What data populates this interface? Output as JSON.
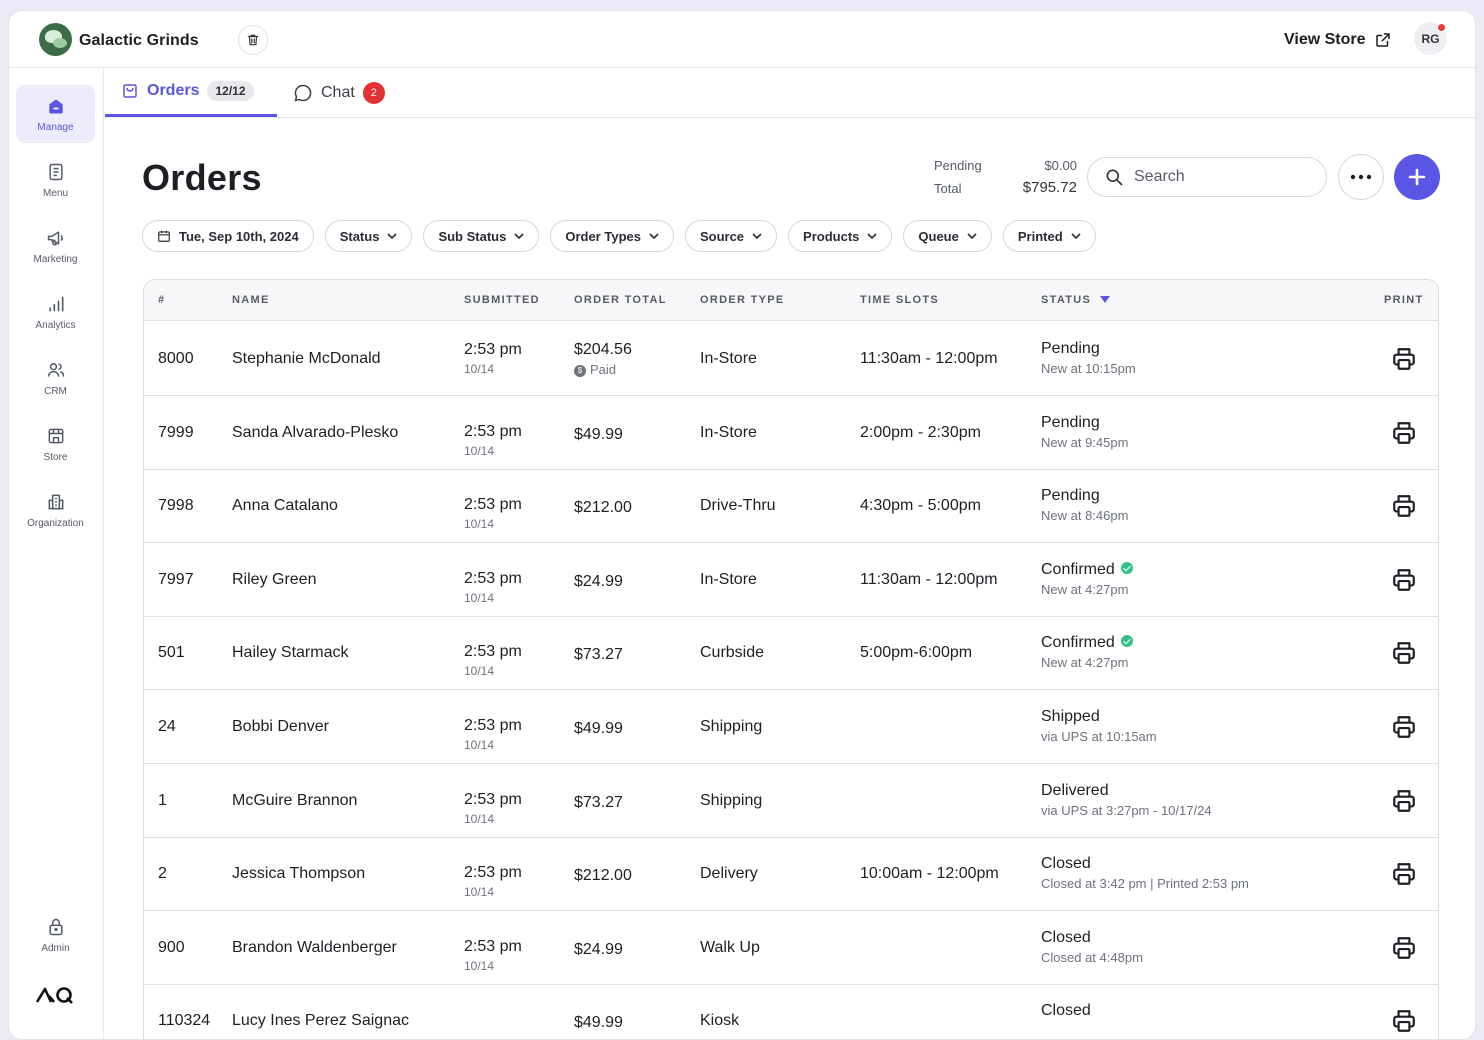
{
  "brand": {
    "name": "Galactic Grinds"
  },
  "header": {
    "view_store_label": "View Store",
    "avatar_initials": "RG"
  },
  "sidebar": {
    "items": [
      {
        "label": "Manage",
        "icon": "home-icon",
        "active": true
      },
      {
        "label": "Menu",
        "icon": "menu-document-icon"
      },
      {
        "label": "Marketing",
        "icon": "megaphone-icon"
      },
      {
        "label": "Analytics",
        "icon": "bar-chart-icon"
      },
      {
        "label": "CRM",
        "icon": "users-icon"
      },
      {
        "label": "Store",
        "icon": "store-icon"
      },
      {
        "label": "Organization",
        "icon": "building-icon"
      }
    ],
    "admin_label": "Admin"
  },
  "tabs": {
    "orders_label": "Orders",
    "orders_count": "12/12",
    "chat_label": "Chat",
    "chat_count": "2"
  },
  "page": {
    "title": "Orders"
  },
  "summary": {
    "pending_label": "Pending",
    "pending_value": "$0.00",
    "total_label": "Total",
    "total_value": "$795.72"
  },
  "search": {
    "placeholder": "Search"
  },
  "filters": {
    "date": "Tue, Sep 10th, 2024",
    "status": "Status",
    "sub_status": "Sub Status",
    "order_types": "Order Types",
    "source": "Source",
    "products": "Products",
    "queue": "Queue",
    "printed": "Printed"
  },
  "table": {
    "columns": {
      "num": "#",
      "name": "NAME",
      "submitted": "SUBMITTED",
      "order_total": "ORDER TOTAL",
      "order_type": "ORDER TYPE",
      "time_slots": "TIME SLOTS",
      "status": "STATUS",
      "print": "PRINT"
    },
    "rows": [
      {
        "num": "8000",
        "name": "Stephanie McDonald",
        "time": "2:53 pm",
        "date": "10/14",
        "total": "$204.56",
        "total_note": "Paid",
        "type": "In-Store",
        "slot": "11:30am - 12:00pm",
        "status": "Pending",
        "status_sub": "New at 10:15pm"
      },
      {
        "num": "7999",
        "name": "Sanda Alvarado-Plesko",
        "time": "2:53 pm",
        "date": "10/14",
        "total": "$49.99",
        "type": "In-Store",
        "slot": "2:00pm - 2:30pm",
        "status": "Pending",
        "status_sub": "New at 9:45pm"
      },
      {
        "num": "7998",
        "name": "Anna Catalano",
        "time": "2:53 pm",
        "date": "10/14",
        "total": "$212.00",
        "type": "Drive-Thru",
        "slot": "4:30pm - 5:00pm",
        "status": "Pending",
        "status_sub": "New at 8:46pm"
      },
      {
        "num": "7997",
        "name": "Riley Green",
        "time": "2:53 pm",
        "date": "10/14",
        "total": "$24.99",
        "type": "In-Store",
        "slot": "11:30am - 12:00pm",
        "status": "Confirmed",
        "status_sub": "New at 4:27pm",
        "confirmed": true
      },
      {
        "num": "501",
        "name": "Hailey Starmack",
        "time": "2:53 pm",
        "date": "10/14",
        "total": "$73.27",
        "type": "Curbside",
        "slot": "5:00pm-6:00pm",
        "status": "Confirmed",
        "status_sub": "New at 4:27pm",
        "confirmed": true
      },
      {
        "num": "24",
        "name": "Bobbi Denver",
        "time": "2:53 pm",
        "date": "10/14",
        "total": "$49.99",
        "type": "Shipping",
        "slot": "",
        "status": "Shipped",
        "status_sub": "via UPS at 10:15am"
      },
      {
        "num": "1",
        "name": "McGuire Brannon",
        "time": "2:53 pm",
        "date": "10/14",
        "total": "$73.27",
        "type": "Shipping",
        "slot": "",
        "status": "Delivered",
        "status_sub": "via UPS at 3:27pm - 10/17/24"
      },
      {
        "num": "2",
        "name": "Jessica Thompson",
        "time": "2:53 pm",
        "date": "10/14",
        "total": "$212.00",
        "type": "Delivery",
        "slot": "10:00am - 12:00pm",
        "status": "Closed",
        "status_sub": "Closed at 3:42 pm | Printed 2:53 pm"
      },
      {
        "num": "900",
        "name": "Brandon Waldenberger",
        "time": "2:53 pm",
        "date": "10/14",
        "total": "$24.99",
        "type": "Walk Up",
        "slot": "",
        "status": "Closed",
        "status_sub": "Closed at 4:48pm"
      },
      {
        "num": "110324",
        "name": "Lucy Ines Perez Saignac",
        "time": "",
        "date": "",
        "total": "$49.99",
        "type": "Kiosk",
        "slot": "",
        "status": "Closed",
        "status_sub": ""
      }
    ]
  },
  "colors": {
    "accent": "#5a55e0",
    "badge_red": "#e33131",
    "confirmed_green": "#35c08a"
  }
}
